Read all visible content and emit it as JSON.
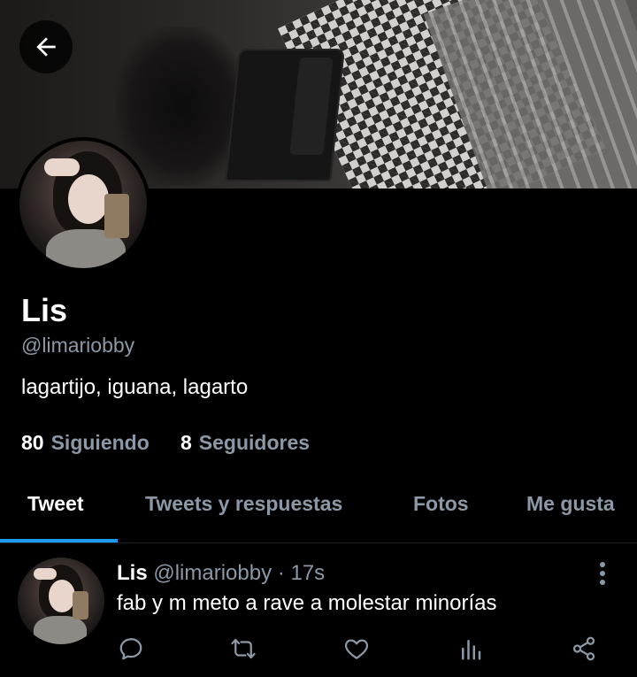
{
  "profile": {
    "name": "Lis",
    "handle": "@limariobby",
    "bio": "lagartijo, iguana, lagarto",
    "following_count": "80",
    "following_label": "Siguiendo",
    "followers_count": "8",
    "followers_label": "Seguidores"
  },
  "tabs": [
    {
      "label": "Tweet",
      "active": true
    },
    {
      "label": "Tweets y respuestas",
      "active": false
    },
    {
      "label": "Fotos",
      "active": false
    },
    {
      "label": "Me gusta",
      "active": false
    }
  ],
  "tweet": {
    "author_name": "Lis",
    "author_handle": "@limariobby",
    "separator": "·",
    "time": "17s",
    "text": "fab y m meto a rave a molestar minorías"
  },
  "icons": {
    "back": "arrow-left-icon",
    "more": "more-vertical-icon",
    "reply": "reply-icon",
    "retweet": "retweet-icon",
    "like": "heart-icon",
    "analytics": "analytics-icon",
    "share": "share-icon"
  },
  "colors": {
    "background": "#000000",
    "text_primary": "#ffffff",
    "text_secondary": "#8b98a5",
    "accent": "#1d9bf0"
  }
}
